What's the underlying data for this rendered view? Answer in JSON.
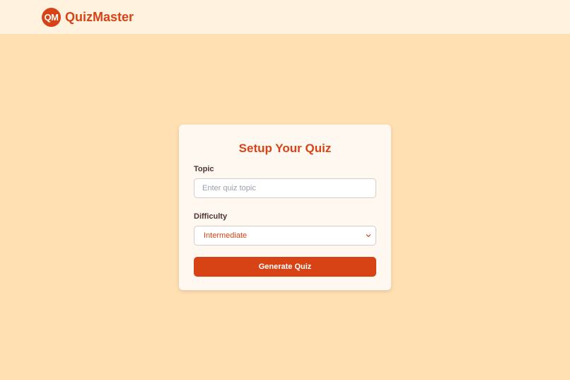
{
  "header": {
    "logo_text": "QM",
    "brand": "QuizMaster"
  },
  "card": {
    "title": "Setup Your Quiz",
    "topic": {
      "label": "Topic",
      "placeholder": "Enter quiz topic",
      "value": ""
    },
    "difficulty": {
      "label": "Difficulty",
      "selected": "Intermediate"
    },
    "generate_label": "Generate Quiz"
  },
  "colors": {
    "page_background": "#ffe0b2",
    "header_background": "#fff3e0",
    "accent": "#d84315",
    "card_background": "#fff8f1"
  },
  "icons": {
    "logo": "qm-logo-badge",
    "select_arrow": "chevron-down-icon"
  }
}
